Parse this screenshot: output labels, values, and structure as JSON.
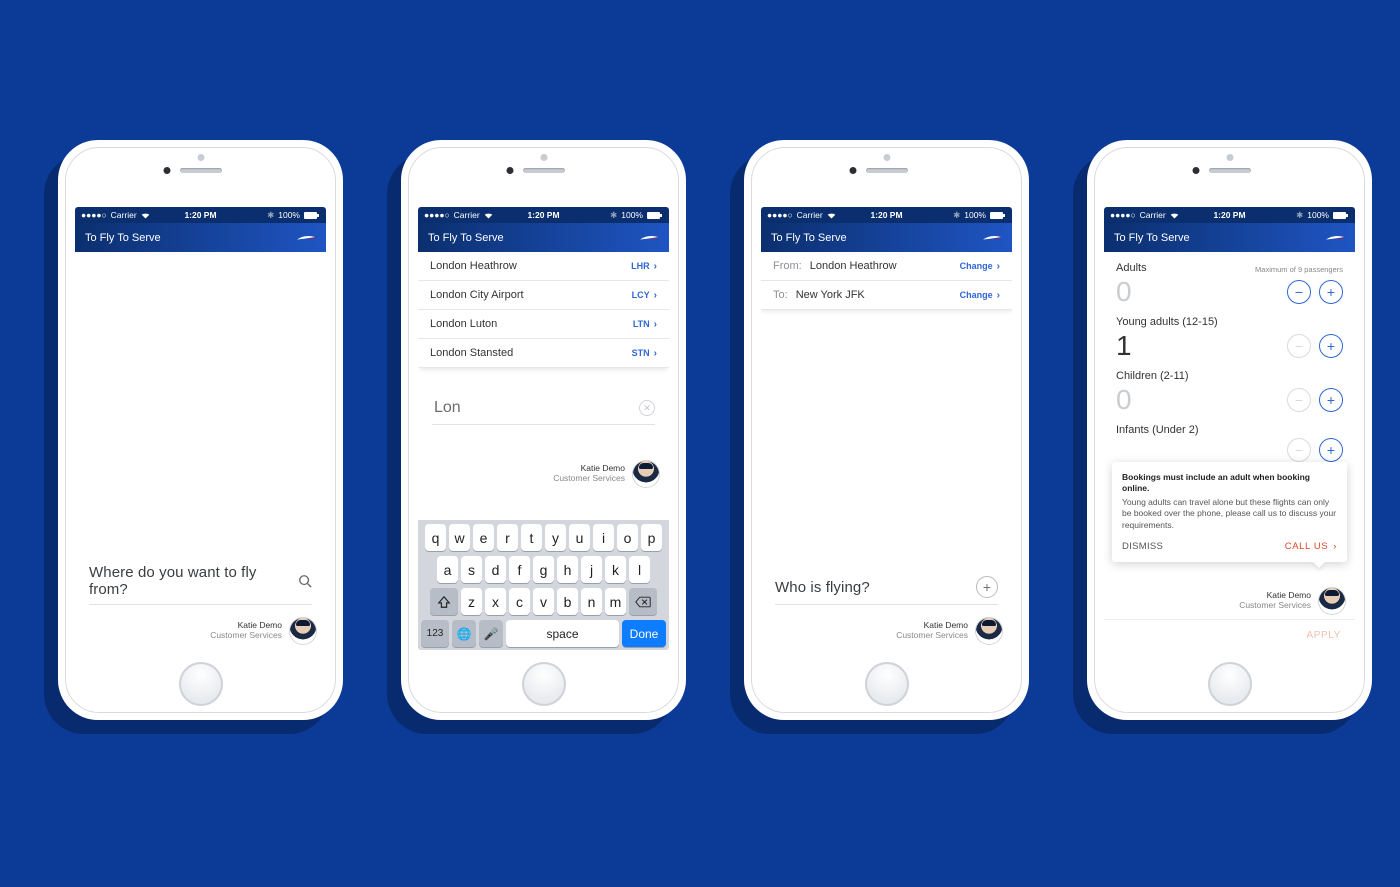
{
  "statusbar": {
    "carrier": "Carrier",
    "signal": "●●●●○",
    "time": "1:20 PM",
    "battery": "100%"
  },
  "navbar": {
    "title": "To Fly To Serve"
  },
  "agent": {
    "name": "Katie Demo",
    "role": "Customer Services"
  },
  "screen1": {
    "prompt": "Where do you want to fly from?"
  },
  "screen2": {
    "airports": [
      {
        "name": "London Heathrow",
        "code": "LHR"
      },
      {
        "name": "London City Airport",
        "code": "LCY"
      },
      {
        "name": "London Luton",
        "code": "LTN"
      },
      {
        "name": "London Stansted",
        "code": "STN"
      }
    ],
    "search_value": "Lon",
    "keyboard": {
      "row1": [
        "q",
        "w",
        "e",
        "r",
        "t",
        "y",
        "u",
        "i",
        "o",
        "p"
      ],
      "row2": [
        "a",
        "s",
        "d",
        "f",
        "g",
        "h",
        "j",
        "k",
        "l"
      ],
      "row3": [
        "z",
        "x",
        "c",
        "v",
        "b",
        "n",
        "m"
      ],
      "num": "123",
      "space": "space",
      "done": "Done"
    }
  },
  "screen3": {
    "from_label": "From:",
    "from_value": "London Heathrow",
    "from_action": "Change",
    "to_label": "To:",
    "to_value": "New York JFK",
    "to_action": "Change",
    "prompt": "Who is flying?"
  },
  "screen4": {
    "groups": [
      {
        "label": "Adults",
        "count": "0",
        "zero": true,
        "note": "Maximum of 9 passengers",
        "minus_enabled": true,
        "plus_enabled": true
      },
      {
        "label": "Young adults (12-15)",
        "count": "1",
        "zero": false,
        "note": "",
        "minus_enabled": false,
        "plus_enabled": true
      },
      {
        "label": "Children (2-11)",
        "count": "0",
        "zero": true,
        "note": "",
        "minus_enabled": false,
        "plus_enabled": true
      },
      {
        "label": "Infants (Under 2)",
        "count": "",
        "zero": true,
        "note": "",
        "minus_enabled": false,
        "plus_enabled": true
      }
    ],
    "alert": {
      "title": "Bookings must include an adult when booking online.",
      "body": "Young adults can travel alone but these flights can only be booked over the phone, please call us to discuss your requirements.",
      "dismiss": "DISMISS",
      "callus": "CALL US"
    },
    "apply": "APPLY"
  }
}
